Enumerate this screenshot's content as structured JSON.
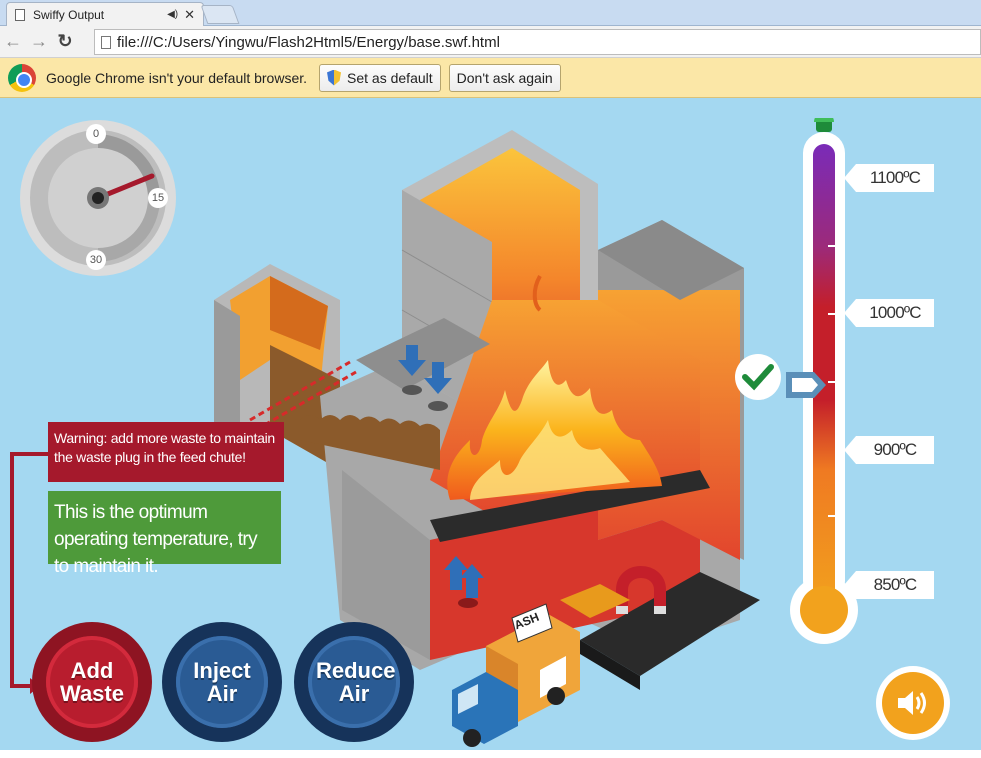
{
  "browser": {
    "tab_title": "Swiffy Output",
    "url": "file:///C:/Users/Yingwu/Flash2Html5/Energy/base.swf.html",
    "infobar_message": "Google Chrome isn't your default browser.",
    "set_default_label": "Set as default",
    "dont_ask_label": "Don't ask again"
  },
  "game": {
    "gauge": {
      "ticks": [
        "0",
        "15",
        "30"
      ],
      "value": 15
    },
    "warning_text": "Warning: add more waste to maintain the waste plug in the feed chute!",
    "optimum_text": "This is the optimum operating temperature, try to maintain it.",
    "thermometer": {
      "labels": [
        "1100ºC",
        "1000ºC",
        "900ºC",
        "850ºC"
      ],
      "pointer_temp": 950
    },
    "truck_label": "ASH",
    "buttons": {
      "add_waste": "Add Waste",
      "inject_air": "Inject Air",
      "reduce_air": "Reduce Air"
    }
  },
  "colors": {
    "sky": "#a4d8f1",
    "warning": "#a5192c",
    "optimum": "#4e9a3a",
    "button_red": "#b81d2e",
    "button_blue": "#2a5b94",
    "sound": "#f2a21d"
  }
}
